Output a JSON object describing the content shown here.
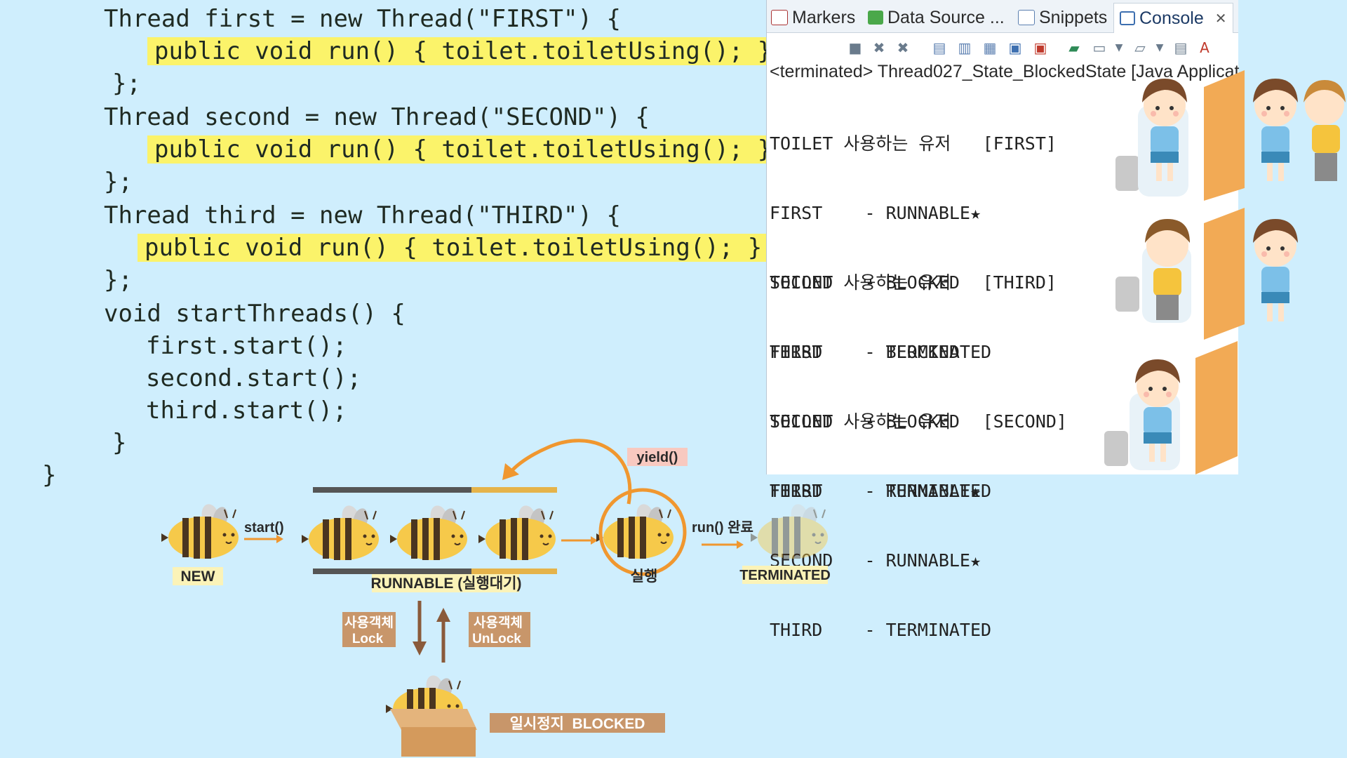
{
  "code": {
    "lines": [
      "Thread first = new Thread(\"FIRST\") {",
      "public void run() { toilet.toiletUsing(); };",
      "};",
      "Thread second = new Thread(\"SECOND\") {",
      "public void run() { toilet.toiletUsing(); };",
      "};",
      "Thread third = new Thread(\"THIRD\") {",
      "public void run() { toilet.toiletUsing(); };",
      "};",
      "void startThreads() {",
      "first.start();",
      "second.start();",
      "third.start();",
      "}",
      "}"
    ]
  },
  "console": {
    "tabs": [
      "Markers",
      "Data Source ...",
      "Snippets",
      "Console"
    ],
    "close_icon": "✕",
    "status": "<terminated> Thread027_State_BlockedState [Java Applicat",
    "blocks": [
      {
        "header": "TOILET 사용하는 유저   [FIRST]",
        "lines": [
          "FIRST    - RUNNABLE★",
          "SECOND   - BLOCKED",
          "THIRD    - BLOCKED"
        ]
      },
      {
        "header": "TOILET 사용하는 유저   [THIRD]",
        "lines": [
          "FIRST    - TERMINATED",
          "SECOND   - BLOCKED",
          "THIRD    - RUNNABLE★"
        ]
      },
      {
        "header": "TOILET 사용하는 유저   [SECOND]",
        "lines": [
          "FIRST    - TERMINATED",
          "SECOND   - RUNNABLE★",
          "THIRD    - TERMINATED"
        ]
      }
    ]
  },
  "diagram": {
    "new_label": "NEW",
    "start_label": "start()",
    "runnable_label": "RUNNABLE (실행대기)",
    "yield_label": "yield()",
    "running_label": "실행",
    "run_done_label": "run() 완료",
    "terminated_label": "TERMINATED",
    "lock_label_1": "사용객체",
    "lock_label_2": "Lock",
    "unlock_label_1": "사용객체",
    "unlock_label_2": "UnLock",
    "blocked_label": "일시정지  BLOCKED"
  },
  "colors": {
    "background": "#cfeefd",
    "highlight": "#fbf36a",
    "accent_orange": "#f0972f",
    "brown": "#c8966a",
    "door": "#f2aa55"
  }
}
